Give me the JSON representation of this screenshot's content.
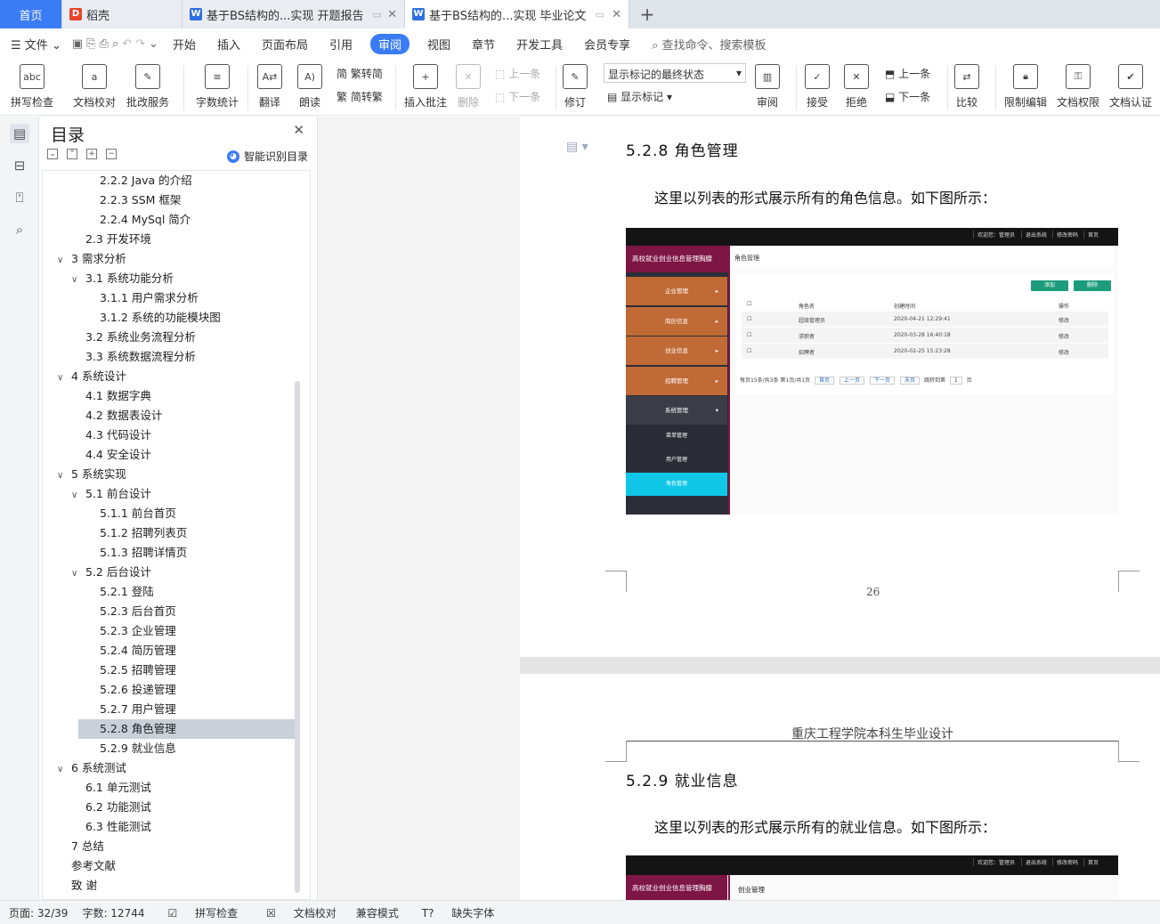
{
  "tabs": {
    "home": "首页",
    "wps": "稻壳",
    "doc1": "基于BS结构的...实现 开题报告",
    "doc2": "基于BS结构的...实现 毕业论文"
  },
  "menu": {
    "file": "文件",
    "items": [
      "开始",
      "插入",
      "页面布局",
      "引用",
      "审阅",
      "视图",
      "章节",
      "开发工具",
      "会员专享"
    ],
    "search_placeholder": "查找命令、搜索模板"
  },
  "ribbon": {
    "spell": "拼写检查",
    "proof": "文档校对",
    "batch": "批改服务",
    "wordcount": "字数统计",
    "translate": "翻译",
    "read": "朗读",
    "t2s": "繁转简",
    "s2t": "简转繁",
    "insert_comment": "插入批注",
    "delete": "删除",
    "prev": "上一条",
    "next": "下一条",
    "revise": "修订",
    "markup_select": "显示标记的最终状态",
    "show_markup": "显示标记",
    "review": "审阅",
    "accept": "接受",
    "reject": "拒绝",
    "prev2": "上一条",
    "next2": "下一条",
    "compare": "比较",
    "restrict": "限制编辑",
    "perm": "文档权限",
    "cert": "文档认证"
  },
  "toc": {
    "title": "目录",
    "smart": "智能识别目录",
    "items": [
      {
        "t": "2.2.2 Java 的介绍",
        "lv": 3
      },
      {
        "t": "2.2.3 SSM 框架",
        "lv": 3
      },
      {
        "t": "2.2.4 MySql 简介",
        "lv": 3
      },
      {
        "t": "2.3  开发环境",
        "lv": 2
      },
      {
        "t": "3  需求分析",
        "lv": 1,
        "c": "⌄"
      },
      {
        "t": "3.1  系统功能分析",
        "lv": 2,
        "c": "⌄"
      },
      {
        "t": "3.1.1  用户需求分析",
        "lv": 3
      },
      {
        "t": "3.1.2  系统的功能模块图",
        "lv": 3
      },
      {
        "t": "3.2  系统业务流程分析",
        "lv": 2
      },
      {
        "t": "3.3  系统数据流程分析",
        "lv": 2
      },
      {
        "t": "4  系统设计",
        "lv": 1,
        "c": "⌄"
      },
      {
        "t": "4.1  数据字典",
        "lv": 2
      },
      {
        "t": "4.2  数据表设计",
        "lv": 2
      },
      {
        "t": "4.3  代码设计",
        "lv": 2
      },
      {
        "t": "4.4  安全设计",
        "lv": 2
      },
      {
        "t": "5  系统实现",
        "lv": 1,
        "c": "⌄"
      },
      {
        "t": "5.1  前台设计",
        "lv": 2,
        "c": "⌄"
      },
      {
        "t": "5.1.1  前台首页",
        "lv": 3
      },
      {
        "t": "5.1.2  招聘列表页",
        "lv": 3
      },
      {
        "t": "5.1.3  招聘详情页",
        "lv": 3
      },
      {
        "t": "5.2  后台设计",
        "lv": 2,
        "c": "⌄"
      },
      {
        "t": "5.2.1  登陆",
        "lv": 3
      },
      {
        "t": "5.2.3  后台首页",
        "lv": 3
      },
      {
        "t": "5.2.3  企业管理",
        "lv": 3
      },
      {
        "t": "5.2.4  简历管理",
        "lv": 3
      },
      {
        "t": "5.2.5  招聘管理",
        "lv": 3
      },
      {
        "t": "5.2.6  投递管理",
        "lv": 3
      },
      {
        "t": "5.2.7  用户管理",
        "lv": 3
      },
      {
        "t": "5.2.8  角色管理",
        "lv": 3,
        "sel": true
      },
      {
        "t": "5.2.9  就业信息",
        "lv": 3
      },
      {
        "t": "6  系统测试",
        "lv": 1,
        "c": "⌄"
      },
      {
        "t": "6.1  单元测试",
        "lv": 2
      },
      {
        "t": "6.2  功能测试",
        "lv": 2
      },
      {
        "t": "6.3  性能测试",
        "lv": 2
      },
      {
        "t": "7  总结",
        "lv": 1
      },
      {
        "t": "参考文献",
        "lv": 1
      },
      {
        "t": "致    谢",
        "lv": 1
      }
    ]
  },
  "doc": {
    "h_528": "5.2.8  角色管理",
    "p_528": "这里以列表的形式展示所有的角色信息。如下图所示：",
    "page_num": "26",
    "header": "重庆工程学院本科生毕业设计",
    "h_529": "5.2.9  就业信息",
    "p_529": "这里以列表的形式展示所有的就业信息。如下图所示："
  },
  "shot1": {
    "top_links": [
      "欢迎您：管理员",
      "退出系统",
      "修改密码",
      "首页"
    ],
    "brand": "高校就业创业信息管理胸腺",
    "menus": [
      "企业管理",
      "简历信息",
      "创业信息",
      "招聘管理",
      "系统管理"
    ],
    "subs": [
      "菜单管理",
      "用户管理",
      "角色管理"
    ],
    "crumb": "角色管理",
    "add": "添加",
    "del": "删除",
    "headers": [
      "角色名",
      "创建时间",
      "操作"
    ],
    "rows": [
      [
        "超级管理员",
        "2020-04-21 12:29:41",
        "修改"
      ],
      [
        "求职者",
        "2020-03-28 16:40:18",
        "修改"
      ],
      [
        "招聘者",
        "2020-02-25 15:23:28",
        "修改"
      ]
    ],
    "pager": "每页15条/共3条 第1页/共1页",
    "pg_btns": [
      "首页",
      "上一页",
      "下一页",
      "末页"
    ],
    "jump": "跳转到第",
    "jump_val": "1",
    "page_unit": "页"
  },
  "shot2": {
    "top_links": [
      "欢迎您：管理员",
      "退出系统",
      "修改密码",
      "首页"
    ],
    "brand": "高校就业创业信息管理胸腺",
    "crumb": "创业管理"
  },
  "status": {
    "page": "页面: 32/39",
    "words": "字数: 12744",
    "spell": "拼写检查",
    "proof": "文档校对",
    "compat": "兼容模式",
    "font": "缺失字体"
  }
}
